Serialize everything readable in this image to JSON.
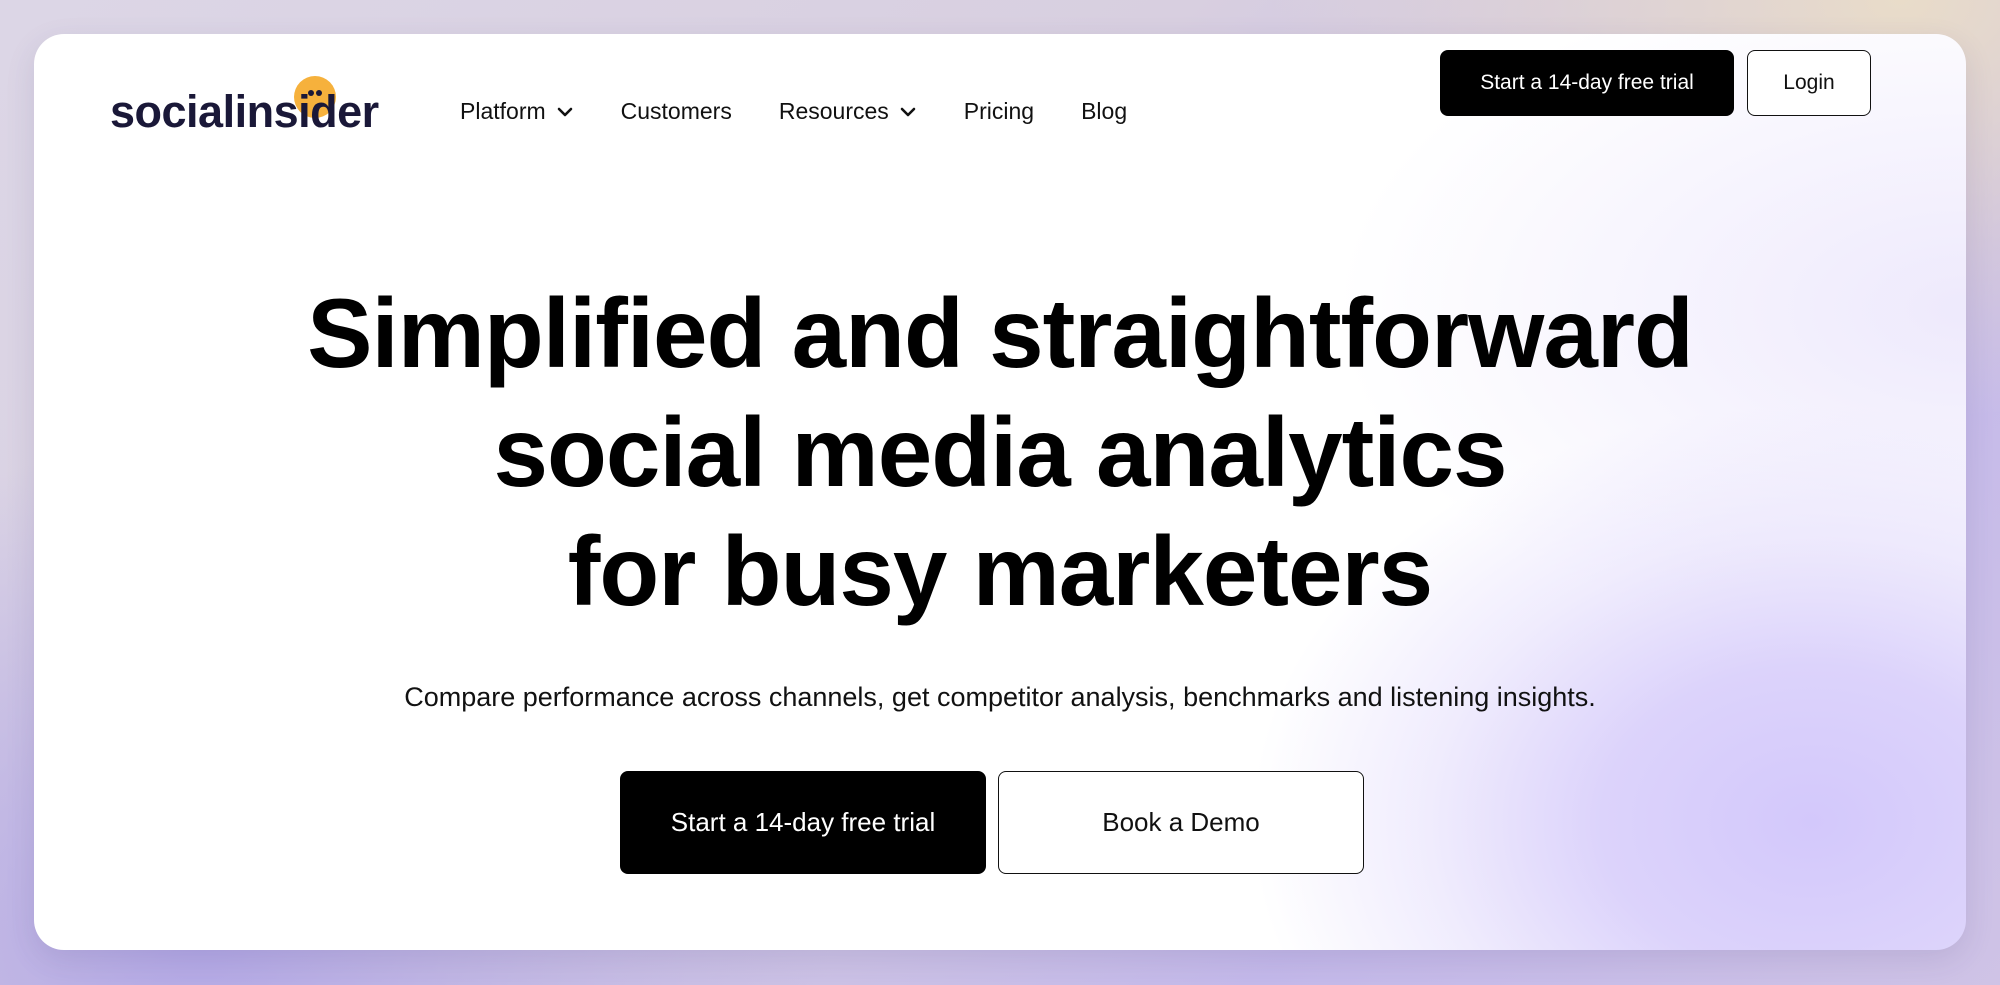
{
  "logo": {
    "text": "socialinsider",
    "accent_color": "#f6b13c",
    "text_color": "#1a1838"
  },
  "nav": {
    "items": [
      {
        "label": "Platform",
        "has_dropdown": true,
        "icon": "chevron-down-icon"
      },
      {
        "label": "Customers",
        "has_dropdown": false
      },
      {
        "label": "Resources",
        "has_dropdown": true,
        "icon": "chevron-down-icon"
      },
      {
        "label": "Pricing",
        "has_dropdown": false
      },
      {
        "label": "Blog",
        "has_dropdown": false
      }
    ],
    "trial_label": "Start a 14-day free trial",
    "login_label": "Login"
  },
  "hero": {
    "title_lines": [
      "Simplified and straightforward",
      "social media analytics",
      "for busy marketers"
    ],
    "subtitle": "Compare performance across channels, get competitor analysis, benchmarks and listening insights.",
    "primary_cta": "Start a 14-day free trial",
    "secondary_cta": "Book a Demo"
  },
  "colors": {
    "primary_button": "#000000",
    "gradient_accent": "#d3c8fb"
  }
}
